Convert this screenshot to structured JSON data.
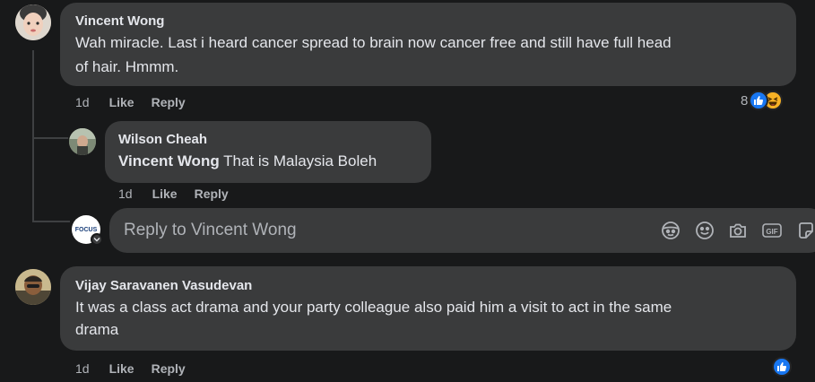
{
  "comments": [
    {
      "author": "Vincent Wong",
      "text_line1": "Wah miracle. Last i heard cancer spread to brain now cancer free and still have full head",
      "text_line2": "of hair. Hmmm.",
      "age": "1d",
      "like_label": "Like",
      "reply_label": "Reply",
      "reaction_count": "8",
      "reactions": [
        "like-icon",
        "haha-icon"
      ]
    },
    {
      "author": "Vijay Saravanen Vasudevan",
      "text_line1": "It was a class act drama and your party colleague also paid him a visit to act in the same",
      "text_line2": "drama",
      "age": "1d",
      "like_label": "Like",
      "reply_label": "Reply",
      "reactions": [
        "like-icon"
      ]
    }
  ],
  "reply": {
    "author": "Wilson Cheah",
    "mention": "Vincent Wong",
    "text": " That is Malaysia Boleh",
    "age": "1d",
    "like_label": "Like",
    "reply_label": "Reply"
  },
  "composer": {
    "avatar_text": "FOCUS",
    "placeholder": "Reply to Vincent Wong",
    "tools": [
      "avatar-sticker-icon",
      "emoji-icon",
      "camera-icon",
      "gif-icon",
      "sticker-icon"
    ]
  },
  "colors": {
    "background": "#18191a",
    "bubble": "#3a3b3c",
    "text": "#e4e6eb",
    "secondary": "#b0b3b8",
    "like_blue": "#1877f2",
    "haha_yellow": "#f7b125"
  }
}
